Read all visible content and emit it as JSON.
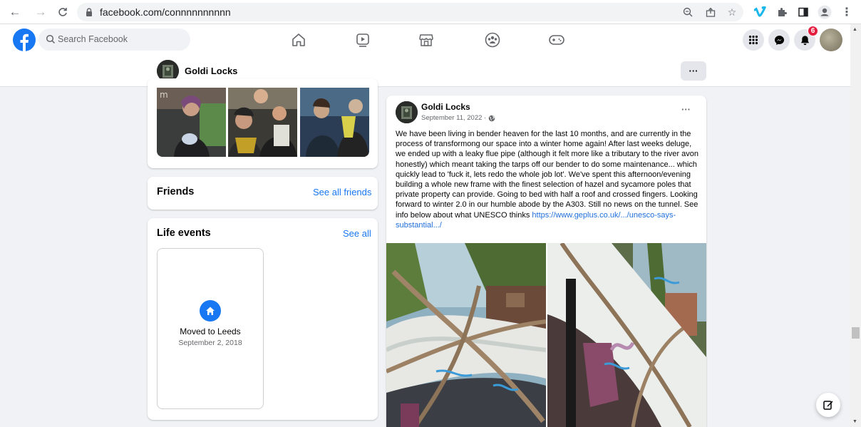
{
  "browser": {
    "url": "facebook.com/connnnnnnnnn"
  },
  "fb_header": {
    "search_placeholder": "Search Facebook",
    "notification_count": "6"
  },
  "profile_bar": {
    "name": "Goldi Locks",
    "more_label": "···"
  },
  "friends_card": {
    "title": "Friends",
    "link": "See all friends"
  },
  "life_events_card": {
    "title": "Life events",
    "link": "See all",
    "event_title": "Moved to Leeds",
    "event_date": "September 2, 2018"
  },
  "post": {
    "author": "Goldi Locks",
    "date": "September 11, 2022 ·",
    "more_label": "···",
    "text": "We have been living in bender heaven for the last 10 months, and are currently in the process of transformong our space into a winter home again! After last weeks deluge, we ended up with a leaky flue pipe (although it felt more like a tributary to the river avon honestly) which meant taking the tarps off our bender to do some maintenance... which quickly lead to 'fuck it, lets redo the whole job lot'. We've spent this afternoon/evening building a whole new frame with the finest selection of hazel and sycamore poles that private property can provide. Going to bed with half a roof and crossed fingers. Looking forward to winter 2.0 in our humble abode by the A303. Still no news on the tunnel. See info below about what UNESCO thinks",
    "link": "https://www.geplus.co.uk/.../unesco-says-substantial.../"
  },
  "colors": {
    "fb_blue": "#1877f2",
    "background": "#f0f2f5",
    "badge_red": "#e41e3f"
  }
}
